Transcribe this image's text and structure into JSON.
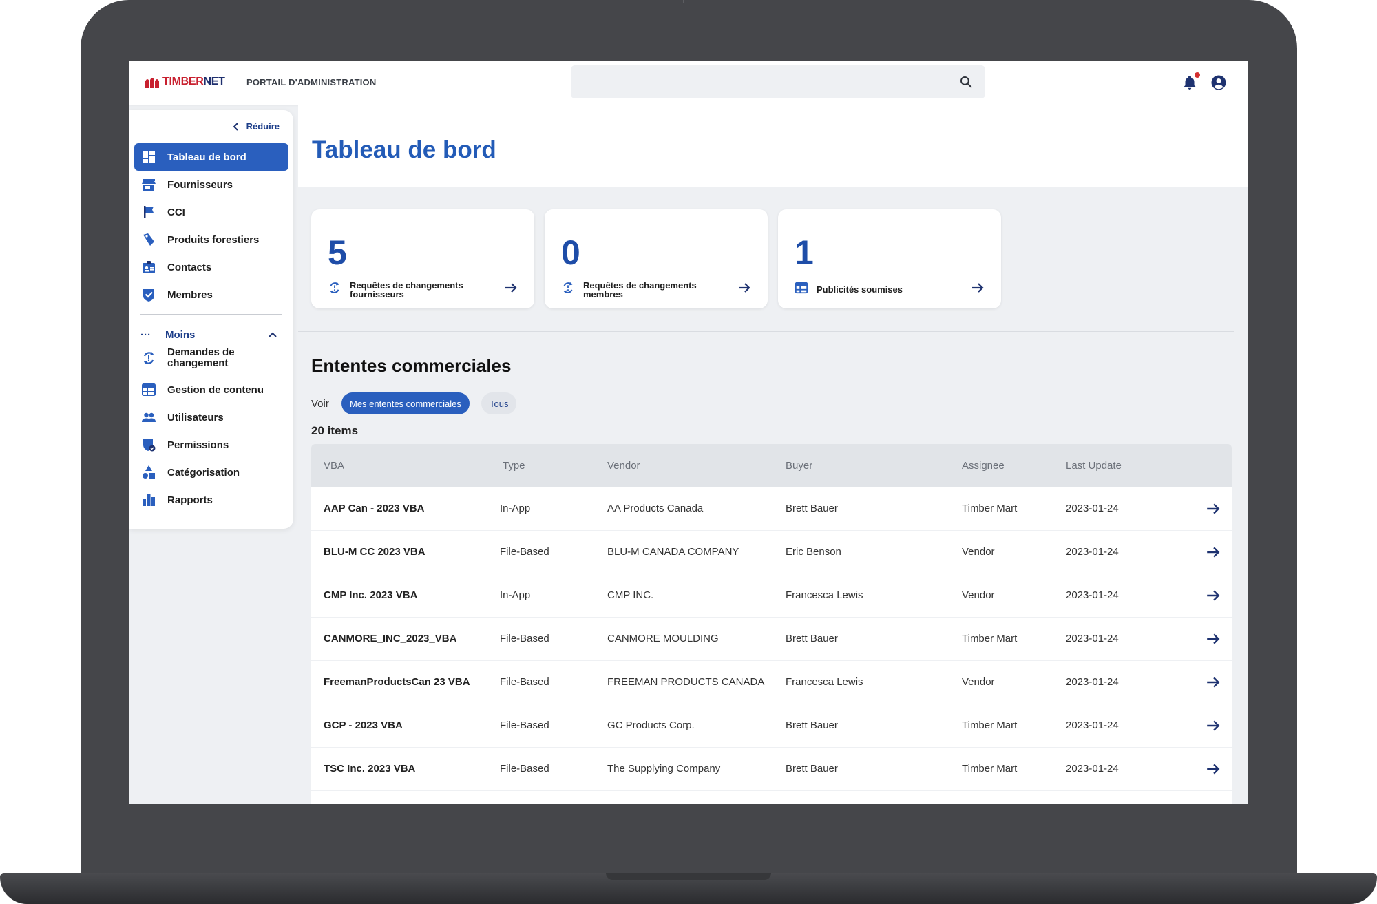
{
  "brand": {
    "logo_primary": "TIMBER",
    "logo_secondary": "NET",
    "portal": "PORTAIL D'ADMINISTRATION",
    "accent": "#2a5fbe",
    "logo_red": "#c8202f",
    "logo_navy": "#1e2f6e"
  },
  "search": {
    "placeholder": ""
  },
  "sidebar": {
    "collapse_label": "Réduire",
    "items": [
      {
        "label": "Tableau de bord",
        "icon": "dashboard-icon"
      },
      {
        "label": "Fournisseurs",
        "icon": "store-icon"
      },
      {
        "label": "CCI",
        "icon": "flag-icon"
      },
      {
        "label": "Produits forestiers",
        "icon": "tag-icon"
      },
      {
        "label": "Contacts",
        "icon": "contact-card-icon"
      },
      {
        "label": "Membres",
        "icon": "verified-icon"
      }
    ],
    "more_label": "Moins",
    "more_items": [
      {
        "label": "Demandes de changement",
        "icon": "sync-icon"
      },
      {
        "label": "Gestion de contenu",
        "icon": "table-icon"
      },
      {
        "label": "Utilisateurs",
        "icon": "people-icon"
      },
      {
        "label": "Permissions",
        "icon": "security-icon"
      },
      {
        "label": "Catégorisation",
        "icon": "shapes-icon"
      },
      {
        "label": "Rapports",
        "icon": "bar-chart-icon"
      }
    ]
  },
  "page": {
    "title": "Tableau de bord"
  },
  "stats": [
    {
      "value": "5",
      "label": "Requêtes de changements fournisseurs"
    },
    {
      "value": "0",
      "label": "Requêtes de changements membres"
    },
    {
      "value": "1",
      "label": "Publicités soumises"
    }
  ],
  "agreements": {
    "title": "Ententes commerciales",
    "view_label": "Voir",
    "filters": [
      "Mes ententes commerciales",
      "Tous"
    ],
    "count": "20 items",
    "columns": [
      "VBA",
      "Type",
      "Vendor",
      "Buyer",
      "Assignee",
      "Last Update"
    ],
    "rows": [
      [
        "AAP Can - 2023 VBA",
        "In-App",
        "AA Products Canada",
        "Brett Bauer",
        "Timber Mart",
        "2023-01-24"
      ],
      [
        "BLU-M CC 2023 VBA",
        "File-Based",
        "BLU-M CANADA COMPANY",
        "Eric Benson",
        "Vendor",
        "2023-01-24"
      ],
      [
        "CMP Inc. 2023 VBA",
        "In-App",
        "CMP INC.",
        "Francesca Lewis",
        "Vendor",
        "2023-01-24"
      ],
      [
        "CANMORE_INC_2023_VBA",
        "File-Based",
        "CANMORE MOULDING",
        "Brett Bauer",
        "Timber Mart",
        "2023-01-24"
      ],
      [
        "FreemanProductsCan 23 VBA",
        "File-Based",
        "FREEMAN PRODUCTS CANADA",
        "Francesca Lewis",
        "Vendor",
        "2023-01-24"
      ],
      [
        "GCP - 2023 VBA",
        "File-Based",
        "GC Products Corp.",
        "Brett Bauer",
        "Timber Mart",
        "2023-01-24"
      ],
      [
        "TSC Inc. 2023 VBA",
        "File-Based",
        "The Supplying Company",
        "Brett Bauer",
        "Timber Mart",
        "2023-01-24"
      ]
    ]
  }
}
